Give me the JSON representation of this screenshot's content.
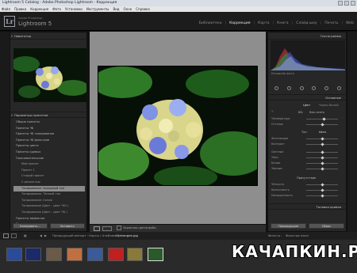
{
  "window": {
    "title": "Lightroom 5 Catalog - Adobe Photoshop Lightroom - Коррекция"
  },
  "menu": [
    "Файл",
    "Правка",
    "Коррекция",
    "Фото",
    "Установки",
    "Инструменты",
    "Вид",
    "Окно",
    "Справка"
  ],
  "brand": {
    "logo": "Lr",
    "small": "Adobe Photoshop",
    "name": "Lightroom 5"
  },
  "modules": [
    "Библиотека",
    "Коррекция",
    "Карта",
    "Книга",
    "Слайд-шоу",
    "Печать",
    "Web"
  ],
  "active_module": "Коррекция",
  "left": {
    "navigator": "Навигатор",
    "presets": "Параметры пресетов",
    "tree": [
      {
        "label": "Общие пресеты",
        "sub": false
      },
      {
        "label": "Пресеты ЧБ",
        "sub": false
      },
      {
        "label": "Пресеты ЧБ тонирования",
        "sub": false
      },
      {
        "label": "Пресеты ЧБ фильтров",
        "sub": false
      },
      {
        "label": "Пресеты цвета",
        "sub": false
      },
      {
        "label": "Пресеты кривых",
        "sub": false
      },
      {
        "label": "Пользовательские",
        "sub": false
      },
      {
        "label": "Мой пресет",
        "sub": true
      },
      {
        "label": "Пресет 1",
        "sub": true
      },
      {
        "label": "Старый пресет",
        "sub": true
      },
      {
        "label": "С резкостью",
        "sub": true
      },
      {
        "label": "Тонирование: Холодный тон",
        "sub": true,
        "selected": true
      },
      {
        "label": "Тонирование: Тёплый тон",
        "sub": true
      },
      {
        "label": "Тонирование: Сепия",
        "sub": true
      },
      {
        "label": "Тонирование (Цвет - цвет ЧБ+)",
        "sub": true
      },
      {
        "label": "Тонирование (Цвет - цвет ЧБ-)",
        "sub": true
      },
      {
        "label": "Пресеты эффектов",
        "sub": false
      },
      {
        "label": "Пресеты видео",
        "sub": false
      }
    ],
    "copy_btn": "Копировать...",
    "paste_btn": "Вставить"
  },
  "right": {
    "histogram": "Гистограмма",
    "original": "Исходное фото",
    "basic": "Основные",
    "treatment": "Цвет",
    "treatment_alt": "Черно-белый",
    "wb": "ББ:",
    "wb_val": "Как снято",
    "sliders_a": [
      {
        "label": "Температура",
        "value": 0.55
      },
      {
        "label": "Оттенок",
        "value": 0.5
      }
    ],
    "tone": "Тон",
    "tone_auto": "Авто",
    "sliders_b": [
      {
        "label": "Экспозиция",
        "value": 0.5
      },
      {
        "label": "Контраст",
        "value": 0.5
      },
      {
        "label": "Светлые",
        "value": 0.5
      },
      {
        "label": "Тени",
        "value": 0.5
      },
      {
        "label": "Белые",
        "value": 0.5
      },
      {
        "label": "Чёрные",
        "value": 0.5
      }
    ],
    "presence": "Присутствие",
    "sliders_c": [
      {
        "label": "Чёткость",
        "value": 0.5
      },
      {
        "label": "Красочность",
        "value": 0.5
      },
      {
        "label": "Насыщенность",
        "value": 0.5
      }
    ],
    "tone_curve": "Тоновая кривая",
    "prev_btn": "Предыдущие",
    "reset_btn": "Сброс"
  },
  "toolbar": {
    "soft_proof": "Экранная цветопроба"
  },
  "filmbar": {
    "path": "Предыдущий импорт : Карты / Альбомы / ",
    "file": "Hydrangea.jpg",
    "filter": "Фильтр :",
    "filter_val": "Фильтры выкл"
  },
  "watermark": "КАЧАПКИН.РУ",
  "colors": {
    "panel": "#272727",
    "center": "#8e8e8e",
    "accent": "#e8e8e8"
  }
}
